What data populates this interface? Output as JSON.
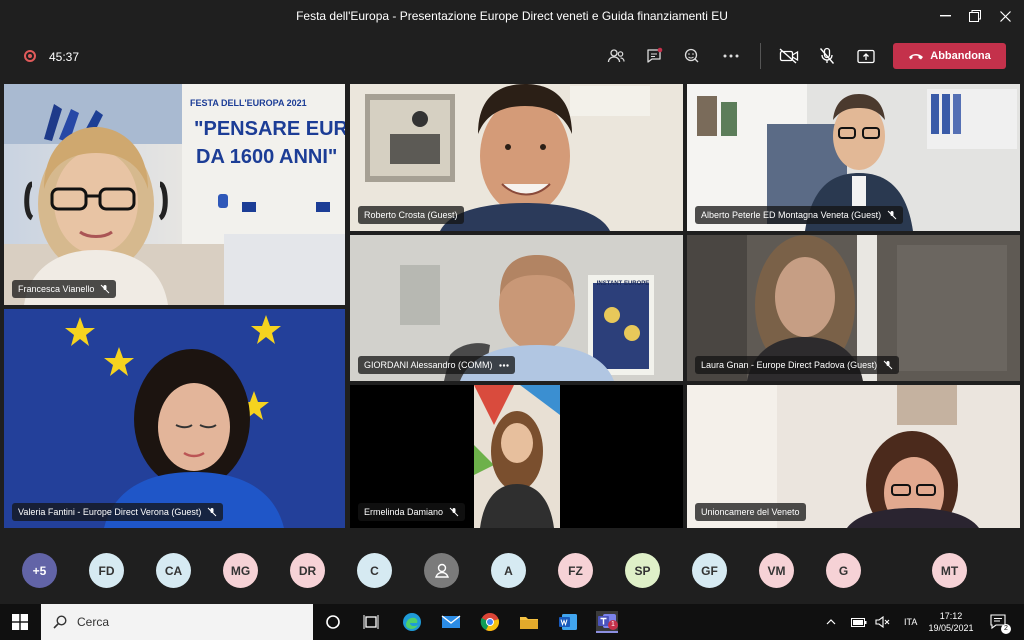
{
  "window": {
    "title": "Festa dell'Europa - Presentazione Europe Direct veneti e Guida finanziamenti EU"
  },
  "toolbar": {
    "timer": "45:37",
    "leave_label": "Abbandona"
  },
  "tiles": [
    {
      "name": "Francesca Vianello"
    },
    {
      "name": "Roberto Crosta (Guest)"
    },
    {
      "name": "Alberto Peterle ED Montagna Veneta (Guest)"
    },
    {
      "name": "GIORDANI Alessandro (COMM)"
    },
    {
      "name": "Laura Gnan - Europe Direct Padova (Guest)"
    },
    {
      "name": "Valeria Fantini - Europe Direct Verona (Guest)"
    },
    {
      "name": "Ermelinda Damiano"
    },
    {
      "name": "Unioncamere del Veneto"
    }
  ],
  "banner": {
    "line1": "FESTA DELL'EUROPA 2021",
    "line2": "\"PENSARE EUROPE",
    "line3": "DA 1600 ANNI\""
  },
  "poster": {
    "text": "INSTANT EUROPE"
  },
  "participants": [
    "+5",
    "FD",
    "CA",
    "MG",
    "DR",
    "C",
    "",
    "A",
    "FZ",
    "SP",
    "GF",
    "VM",
    "G",
    "MT"
  ],
  "taskbar": {
    "search_placeholder": "Cerca",
    "lang": "ITA",
    "time": "17:12",
    "date": "19/05/2021",
    "notif_count": "2",
    "teams_badge": "1"
  }
}
